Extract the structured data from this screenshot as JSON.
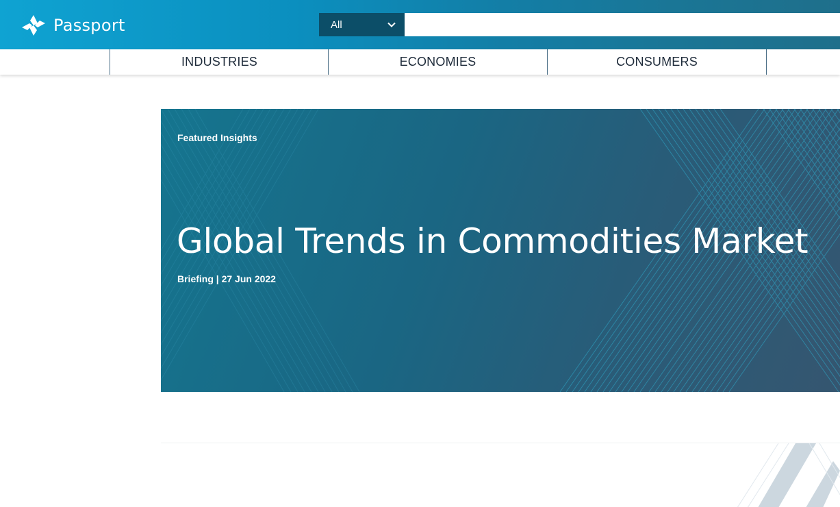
{
  "brand": {
    "name": "Passport"
  },
  "search": {
    "scope": "All",
    "placeholder": ""
  },
  "nav": {
    "items": [
      "INDUSTRIES",
      "ECONOMIES",
      "CONSUMERS"
    ]
  },
  "hero": {
    "kicker": "Featured Insights",
    "title": "Global Trends in Commodities Market",
    "meta": "Briefing | 27 Jun 2022"
  },
  "colors": {
    "header_start": "#0fa3d2",
    "header_end": "#1f6f8b",
    "scope_bg": "#0c4e68",
    "hero_start": "#15758f",
    "hero_end": "#355670"
  },
  "icons": {
    "logo": "passport-logo-icon",
    "dropdown": "chevron-down-icon"
  }
}
